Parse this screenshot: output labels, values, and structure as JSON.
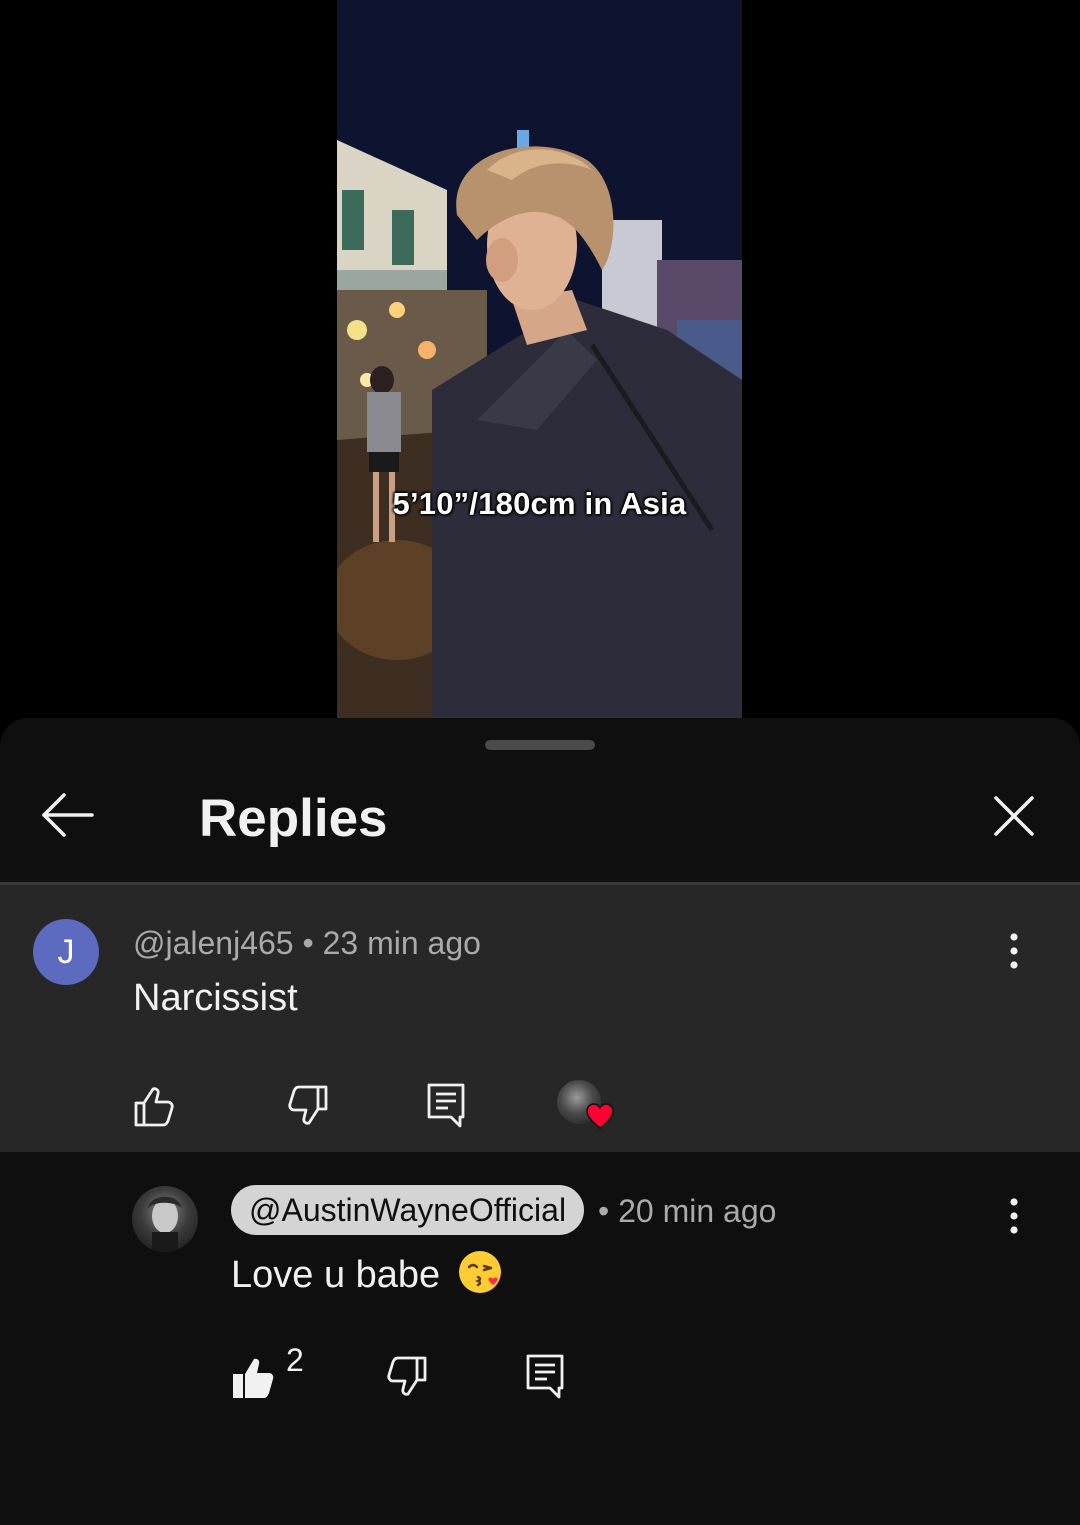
{
  "video": {
    "caption": "5’10”/180cm in Asia"
  },
  "sheet": {
    "title": "Replies",
    "back_icon": "arrow-left-icon",
    "close_icon": "close-icon"
  },
  "parent_comment": {
    "avatar_letter": "J",
    "avatar_color": "#5c6bc0",
    "meta": "@jalenj465 • 23 min ago",
    "text": "Narcissist",
    "actions": [
      "like-icon",
      "dislike-icon",
      "reply-icon"
    ],
    "creator_hearted": true,
    "heart_color": "#ff0033"
  },
  "reply": {
    "author": "@AustinWayneOfficial",
    "time": "• 20 min ago",
    "text": "Love u babe",
    "emoji": "kissing-face-emoji",
    "likes": "2",
    "actions": [
      "like-filled-icon",
      "dislike-icon",
      "reply-icon"
    ]
  },
  "colors": {
    "sheet_bg": "#0f0f0f",
    "highlight_bg": "#272727",
    "chip_bg": "#d4d4d4",
    "muted_text": "#aaaaaa"
  }
}
